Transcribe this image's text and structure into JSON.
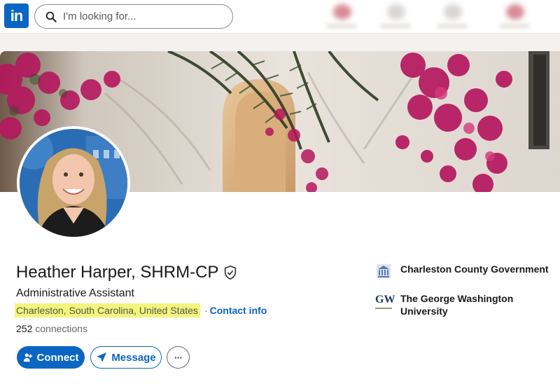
{
  "nav": {
    "logo_text": "in",
    "search_placeholder": "I'm looking for..."
  },
  "profile": {
    "name": "Heather Harper, SHRM-CP",
    "headline": "Administrative Assistant",
    "location": "Charleston, South Carolina, United States",
    "separator": "·",
    "contact_info_label": "Contact info",
    "connections_count": "252",
    "connections_label": "connections"
  },
  "actions": {
    "connect_label": "Connect",
    "message_label": "Message",
    "more_label": "···"
  },
  "organizations": [
    {
      "name": "Charleston County Government",
      "logo": "building-seal-icon"
    },
    {
      "name": "The George Washington University",
      "logo_text": "GW"
    }
  ],
  "colors": {
    "brand_blue": "#0a66c2",
    "highlight": "#f3f57a",
    "page_bg": "#f4f2ee"
  }
}
